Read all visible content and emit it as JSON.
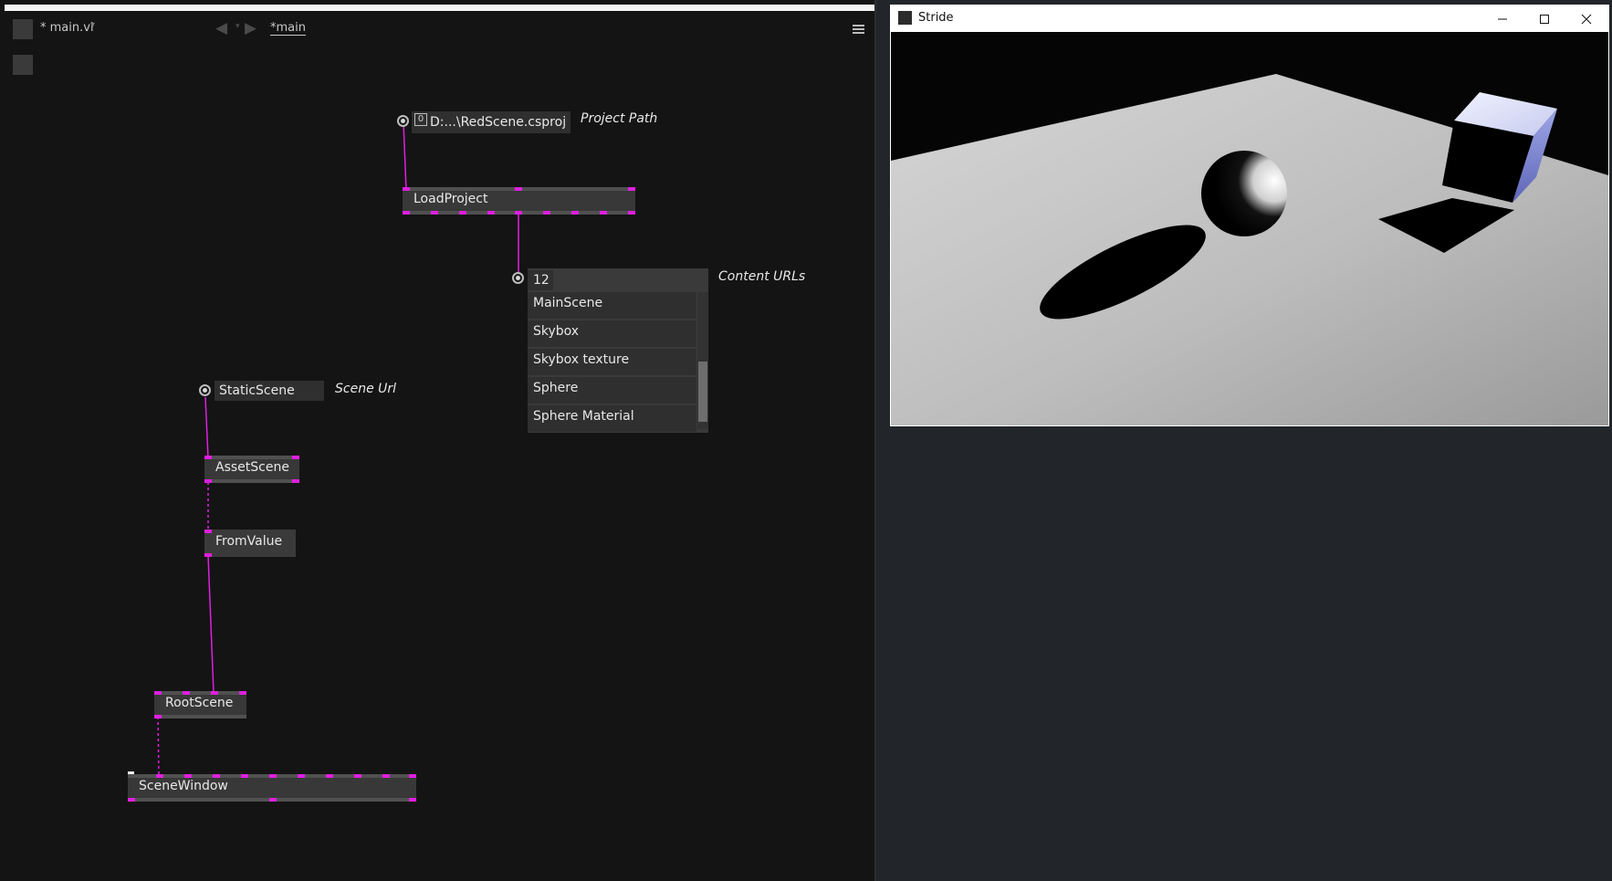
{
  "editor": {
    "document_tab": "* main.vl",
    "breadcrumb": "*main",
    "nav_back_icon": "triangle-left",
    "nav_forward_icon": "triangle-right",
    "menu_icon": "hamburger-menu"
  },
  "patch": {
    "project_path": {
      "value_index": "0",
      "value": "D:...\\RedScene.csproj",
      "comment": "Project Path"
    },
    "load_project_node": "LoadProject",
    "content_urls": {
      "count": "12",
      "items": [
        "MainScene",
        "Skybox",
        "Skybox texture",
        "Sphere",
        "Sphere Material"
      ],
      "comment": "Content URLs"
    },
    "scene_url": {
      "value": "StaticScene",
      "comment": "Scene Url"
    },
    "asset_scene_node": "AssetScene",
    "from_value_node": "FromValue",
    "root_scene_node": "RootScene",
    "scene_window_node": "SceneWindow",
    "link_color": "#e11ee1"
  },
  "stride_window": {
    "title": "Stride",
    "minimize_icon": "minimize",
    "maximize_icon": "maximize",
    "close_icon": "close",
    "viewport_background": "#0a0a0a",
    "floor_color": "#b9b9b9"
  }
}
